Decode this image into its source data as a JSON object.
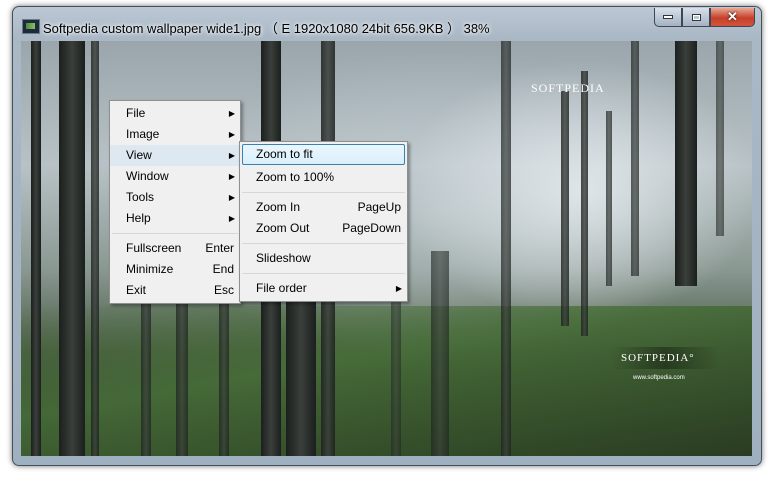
{
  "window": {
    "title": "Softpedia custom wallpaper wide1.jpg （ E  1920x1080  24bit  656.9KB ） 38%",
    "icon": "image-viewer-icon",
    "controls": {
      "minimize": "minimize-icon",
      "maximize": "maximize-icon",
      "close": "close-icon"
    }
  },
  "image": {
    "logo_text": "SOFTPEDIA",
    "logo_text_2": "SOFTPEDIA°",
    "url_text": "www.softpedia.com"
  },
  "context_menu": {
    "items": [
      {
        "label": "File",
        "submenu": true
      },
      {
        "label": "Image",
        "submenu": true
      },
      {
        "label": "View",
        "submenu": true,
        "highlighted": true
      },
      {
        "label": "Window",
        "submenu": true
      },
      {
        "label": "Tools",
        "submenu": true
      },
      {
        "label": "Help",
        "submenu": true
      }
    ],
    "items2": [
      {
        "label": "Fullscreen",
        "shortcut": "Enter"
      },
      {
        "label": "Minimize",
        "shortcut": "End"
      },
      {
        "label": "Exit",
        "shortcut": "Esc"
      }
    ]
  },
  "view_submenu": {
    "zoom_fit": "Zoom to fit",
    "zoom_100": "Zoom to 100%",
    "zoom_in": "Zoom In",
    "zoom_in_sc": "PageUp",
    "zoom_out": "Zoom Out",
    "zoom_out_sc": "PageDown",
    "slideshow": "Slideshow",
    "file_order": "File order"
  },
  "colors": {
    "menu_bg": "#f0f0f0",
    "selection_border": "#3c7fb1",
    "close_button": "#c6402a"
  }
}
